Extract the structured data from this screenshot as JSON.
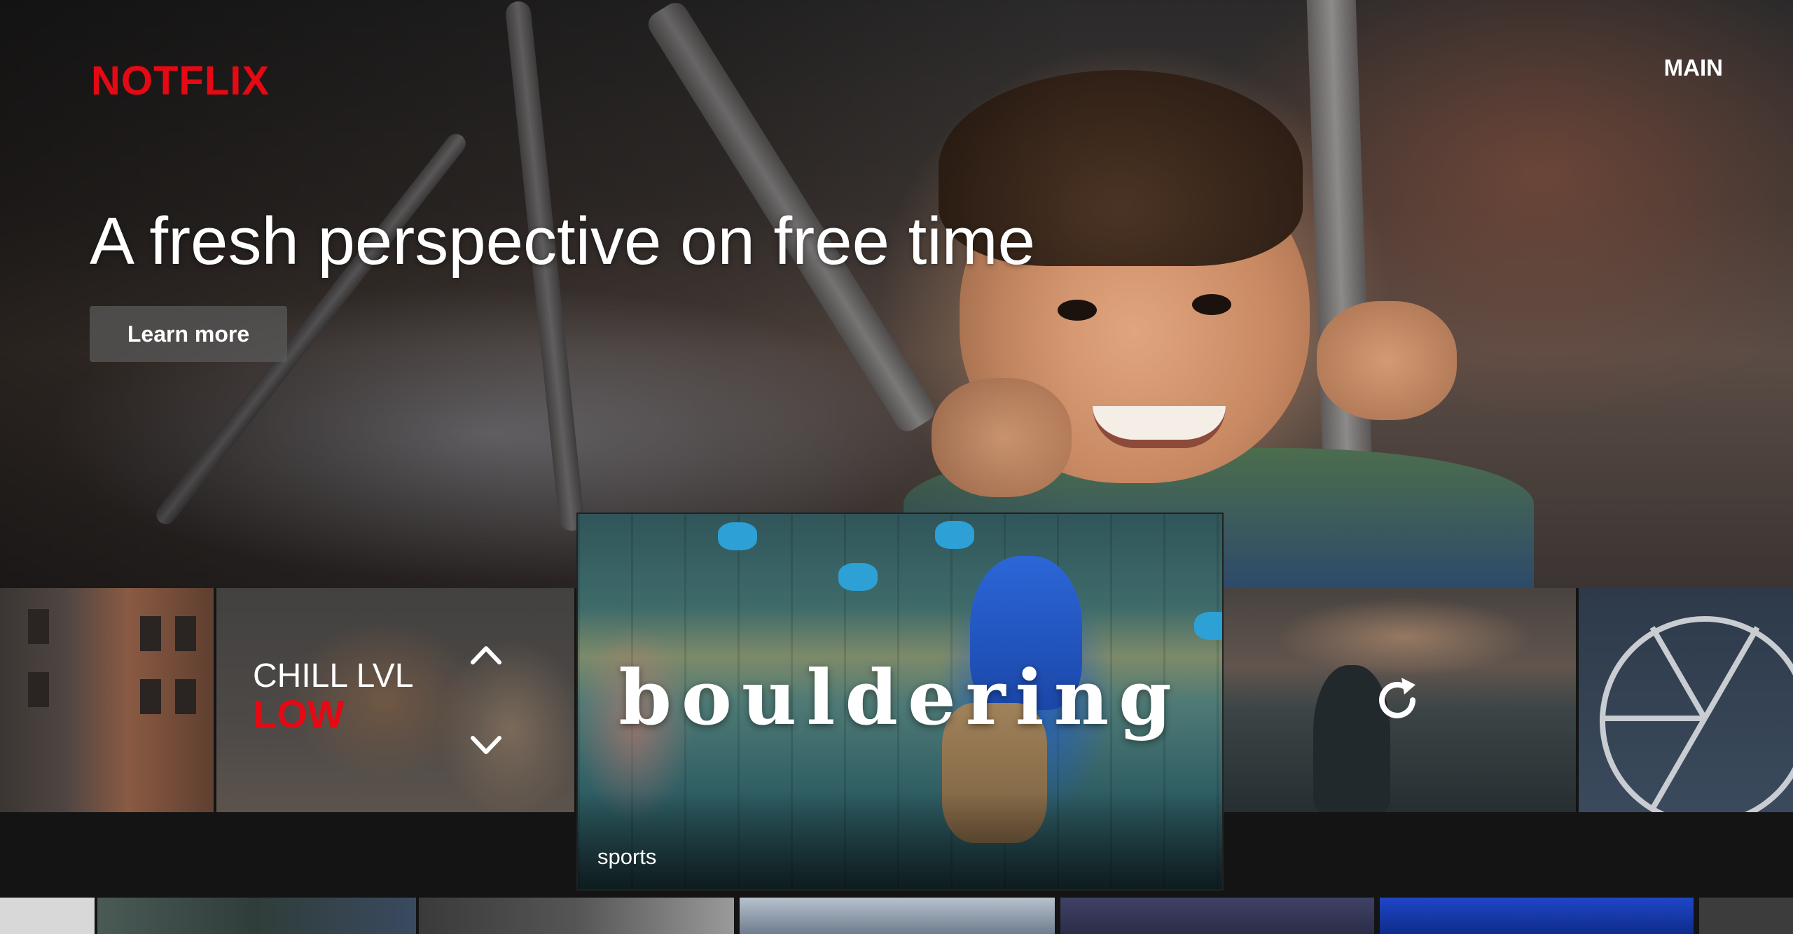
{
  "header": {
    "logo": "NOTFLIX",
    "nav_main": "MAIN"
  },
  "hero": {
    "headline": "A fresh perspective on free time",
    "cta_label": "Learn more"
  },
  "row": {
    "tiles": [
      {
        "type": "image",
        "name": "city-buildings"
      },
      {
        "type": "selector",
        "label": "CHILL LVL",
        "value": "LOW",
        "up_icon": "chevron-up-icon",
        "down_icon": "chevron-down-icon"
      },
      {
        "type": "featured",
        "title": "bouldering",
        "category": "sports"
      },
      {
        "type": "image",
        "name": "yoga-beach",
        "icon": "refresh-icon"
      },
      {
        "type": "image",
        "name": "ferris-wheel"
      }
    ]
  },
  "colors": {
    "brand": "#e50914",
    "background": "#141414",
    "button_bg": "#5a5a5a"
  }
}
